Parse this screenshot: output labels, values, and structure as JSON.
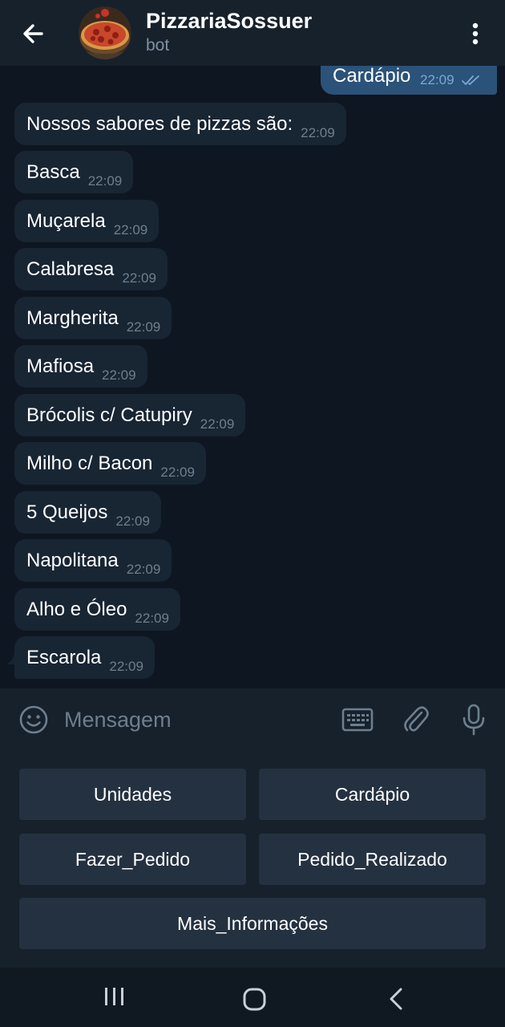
{
  "header": {
    "title": "PizzariaSossuer",
    "subtitle": "bot"
  },
  "outgoing": {
    "text": "Cardápio",
    "time": "22:09"
  },
  "messages": [
    {
      "text": "Nossos sabores de pizzas são:",
      "time": "22:09"
    },
    {
      "text": "Basca",
      "time": "22:09"
    },
    {
      "text": "Muçarela",
      "time": "22:09"
    },
    {
      "text": "Calabresa",
      "time": "22:09"
    },
    {
      "text": "Margherita",
      "time": "22:09"
    },
    {
      "text": "Mafiosa",
      "time": "22:09"
    },
    {
      "text": "Brócolis c/ Catupiry",
      "time": "22:09"
    },
    {
      "text": "Milho c/ Bacon",
      "time": "22:09"
    },
    {
      "text": "5 Queijos",
      "time": "22:09"
    },
    {
      "text": "Napolitana",
      "time": "22:09"
    },
    {
      "text": "Alho e Óleo",
      "time": "22:09"
    },
    {
      "text": "Escarola",
      "time": "22:09"
    }
  ],
  "input": {
    "placeholder": "Mensagem"
  },
  "bot_keyboard": {
    "buttons": [
      "Unidades",
      "Cardápio",
      "Fazer_Pedido",
      "Pedido_Realizado",
      "Mais_Informações"
    ]
  },
  "icons": {
    "back": "arrow-left-icon",
    "menu": "more-vertical-icon",
    "emoji": "emoji-icon",
    "keyboard": "keyboard-icon",
    "attach": "paperclip-icon",
    "mic": "microphone-icon",
    "read": "double-check-icon"
  },
  "colors": {
    "background": "#0e1621",
    "header": "#17212b",
    "incoming_bubble": "#182533",
    "outgoing_bubble": "#2b5278",
    "keyboard_button": "#243140"
  }
}
